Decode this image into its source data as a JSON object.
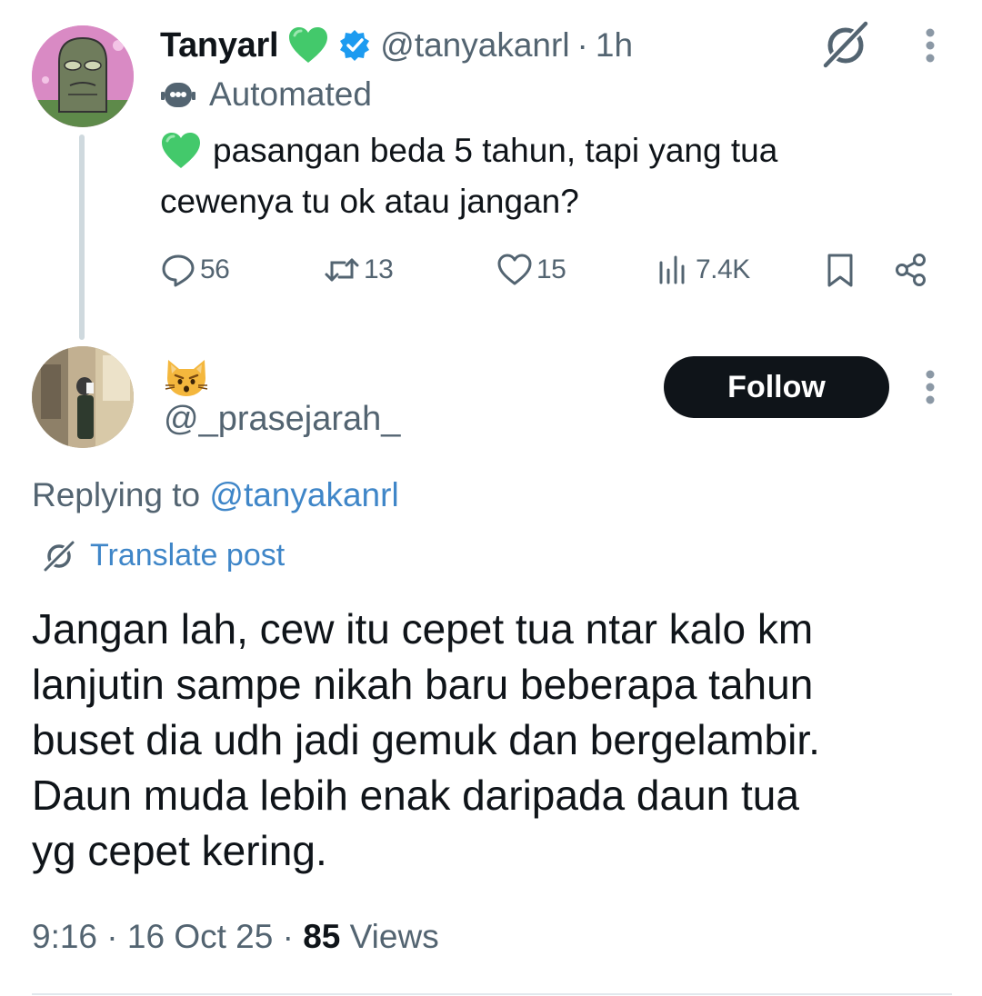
{
  "parent_tweet": {
    "author_name": "Tanyarl",
    "handle": "@tanyakanrl",
    "separator": "·",
    "time": "1h",
    "automated_label": "Automated",
    "text_line1": "pasangan beda 5 tahun, tapi yang tua",
    "text_line2": "cewenya tu ok atau jangan?",
    "text_emoji": "green-heart",
    "actions": {
      "replies": "56",
      "reposts": "13",
      "likes": "15",
      "views": "7.4K"
    }
  },
  "reply_tweet": {
    "display_name_emoji": "cat-face",
    "handle": "@_prasejarah_",
    "follow_label": "Follow",
    "replying_to_prefix": "Replying to ",
    "replying_to_handle": "@tanyakanrl",
    "translate_label": "Translate post",
    "body_lines": [
      "Jangan lah, cew itu cepet tua ntar kalo km",
      "lanjutin sampe nikah baru beberapa tahun",
      "buset dia udh jadi gemuk dan bergelambir.",
      "Daun muda lebih enak daripada daun tua",
      "yg cepet kering."
    ],
    "meta": {
      "time": "9:16",
      "sep1": " · ",
      "date": "16 Oct 25",
      "sep2": " · ",
      "views_count": "85",
      "views_label": " Views"
    }
  },
  "colors": {
    "text_primary": "#0f1419",
    "text_secondary": "#536471",
    "link": "#3f86c8",
    "verified": "#1d9bf0",
    "green_heart": "#43c96b",
    "follow_bg": "#0f1419"
  }
}
